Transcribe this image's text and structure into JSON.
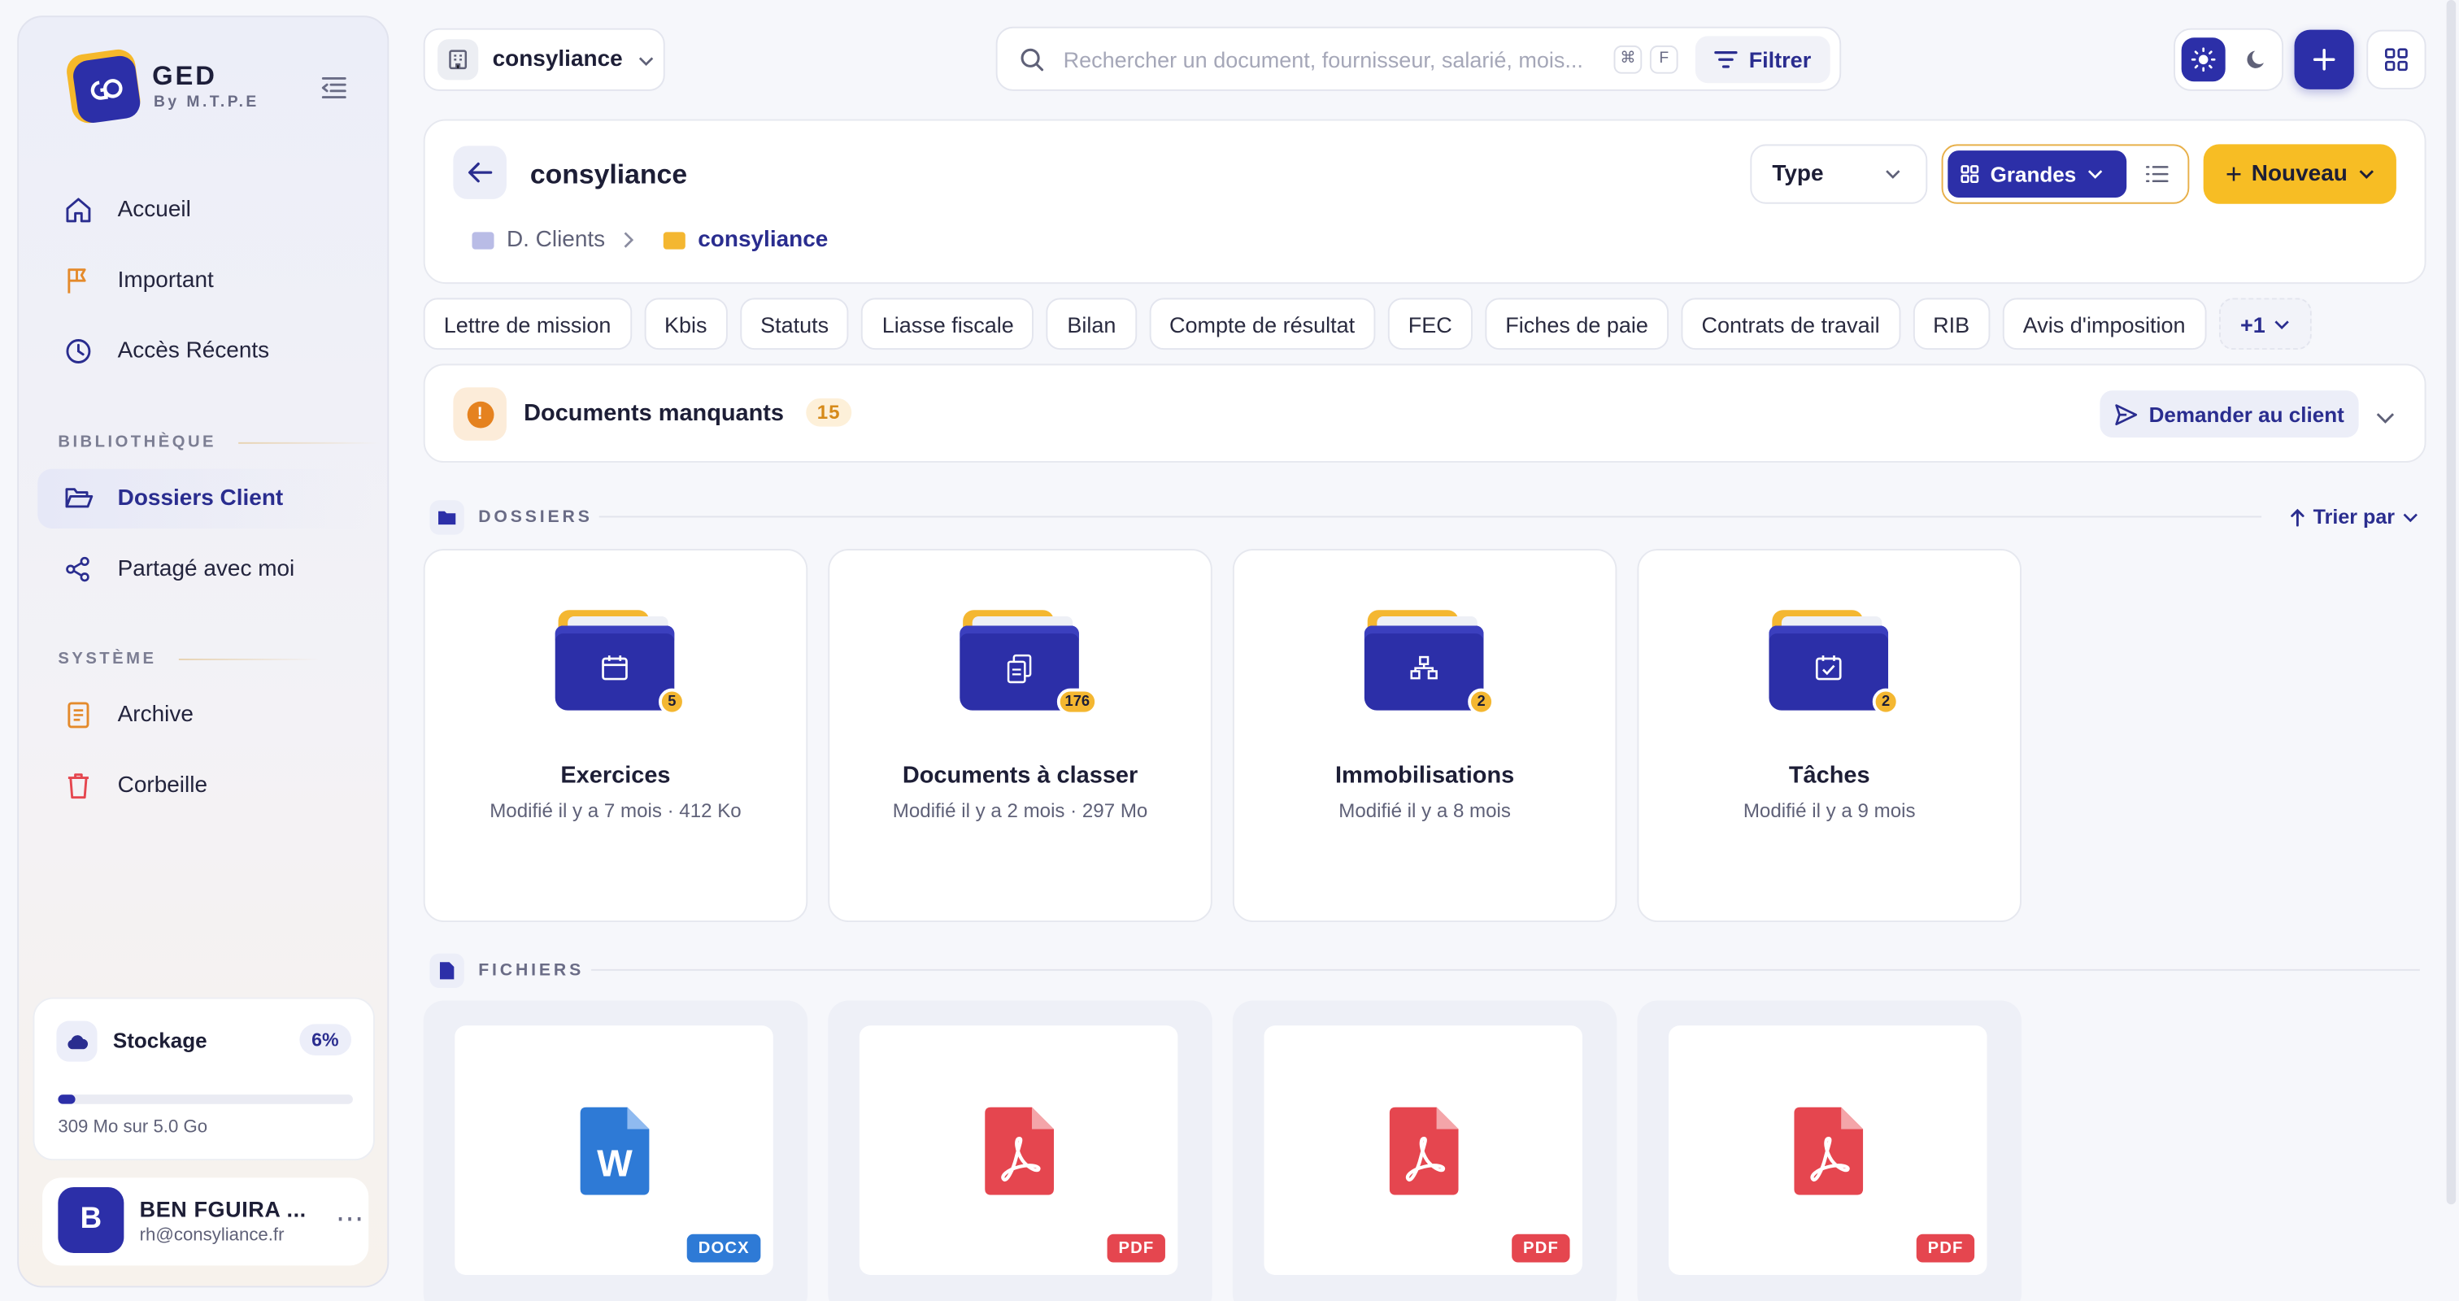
{
  "brand": {
    "title": "GED",
    "subtitle": "By M.T.P.E"
  },
  "sidebar": {
    "main": [
      {
        "label": "Accueil",
        "icon": "home-icon"
      },
      {
        "label": "Important",
        "icon": "flag-icon"
      },
      {
        "label": "Accès Récents",
        "icon": "clock-icon"
      }
    ],
    "library_label": "BIBLIOTHÈQUE",
    "library": [
      {
        "label": "Dossiers Client",
        "icon": "folder-open-icon",
        "active": true
      },
      {
        "label": "Partagé avec moi",
        "icon": "share-icon"
      }
    ],
    "system_label": "SYSTÈME",
    "system": [
      {
        "label": "Archive",
        "icon": "archive-icon"
      },
      {
        "label": "Corbeille",
        "icon": "trash-icon"
      }
    ]
  },
  "storage": {
    "title": "Stockage",
    "percent_label": "6%",
    "percent": 6,
    "usage": "309 Mo sur 5.0 Go"
  },
  "user": {
    "initial": "B",
    "name": "BEN FGUIRA ...",
    "email": "rh@consyliance.fr"
  },
  "topbar": {
    "workspace": "consyliance",
    "search_placeholder": "Rechercher un document, fournisseur, salarié, mois...",
    "kbd_cmd": "⌘",
    "kbd_key": "F",
    "filter_label": "Filtrer"
  },
  "header": {
    "title": "consyliance",
    "breadcrumb_root": "D. Clients",
    "breadcrumb_current": "consyliance",
    "type_label": "Type",
    "view_label": "Grandes",
    "new_label": "Nouveau"
  },
  "chips": [
    "Lettre de mission",
    "Kbis",
    "Statuts",
    "Liasse fiscale",
    "Bilan",
    "Compte de résultat",
    "FEC",
    "Fiches de paie",
    "Contrats de travail",
    "RIB",
    "Avis d'imposition"
  ],
  "chips_more": "+1",
  "missing": {
    "title": "Documents manquants",
    "count": "15",
    "ask_label": "Demander au client",
    "alert_glyph": "!"
  },
  "folders_section": {
    "label": "DOSSIERS",
    "sort_label": "Trier par"
  },
  "folders": [
    {
      "name": "Exercices",
      "meta": "Modifié il y a 7 mois · 412 Ko",
      "count": "5",
      "icon": "calendar-icon"
    },
    {
      "name": "Documents à classer",
      "meta": "Modifié il y a 2 mois · 297 Mo",
      "count": "176",
      "icon": "copy-docs-icon"
    },
    {
      "name": "Immobilisations",
      "meta": "Modifié il y a 8 mois",
      "count": "2",
      "icon": "assets-icon"
    },
    {
      "name": "Tâches",
      "meta": "Modifié il y a 9 mois",
      "count": "2",
      "icon": "calendar-check-icon"
    }
  ],
  "files_section": {
    "label": "FICHIERS"
  },
  "files": [
    {
      "type": "DOCX",
      "color": "#2e7ad6",
      "icon": "word-file-icon"
    },
    {
      "type": "PDF",
      "color": "#e5464f",
      "icon": "pdf-file-icon"
    },
    {
      "type": "PDF",
      "color": "#e5464f",
      "icon": "pdf-file-icon"
    },
    {
      "type": "PDF",
      "color": "#e5464f",
      "icon": "pdf-file-icon"
    }
  ],
  "colors": {
    "primary": "#2c2fa8",
    "accent": "#f7bd24",
    "warning": "#e5821f",
    "pdf": "#e5464f",
    "docx": "#2e7ad6"
  }
}
